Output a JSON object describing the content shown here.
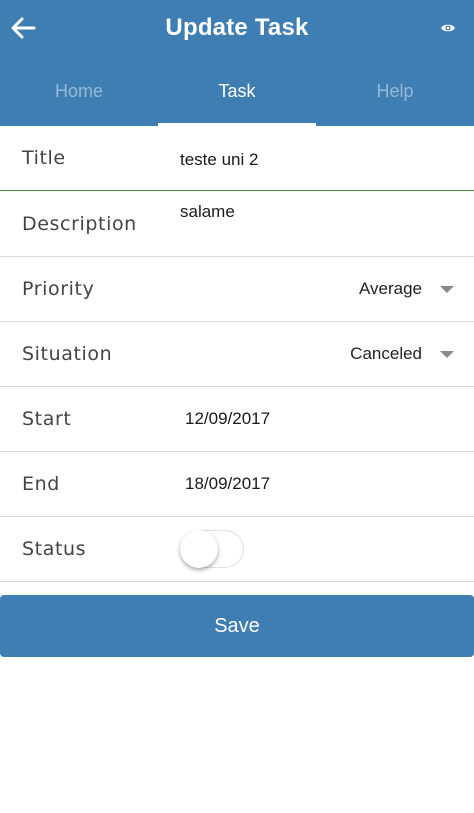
{
  "header": {
    "title": "Update Task",
    "back_icon": "arrow-left-icon",
    "eye_icon": "eye-icon",
    "background_color": "#3f7eb2"
  },
  "tabs": [
    {
      "label": "Home",
      "active": false
    },
    {
      "label": "Task",
      "active": true
    },
    {
      "label": "Help",
      "active": false
    }
  ],
  "form": {
    "title": {
      "label": "Title",
      "value": "teste uni 2"
    },
    "description": {
      "label": "Description",
      "value": "salame"
    },
    "priority": {
      "label": "Priority",
      "value": "Average"
    },
    "situation": {
      "label": "Situation",
      "value": "Canceled"
    },
    "start": {
      "label": "Start",
      "value": "12/09/2017"
    },
    "end": {
      "label": "End",
      "value": "18/09/2017"
    },
    "status": {
      "label": "Status",
      "checked": false
    }
  },
  "save_button": {
    "label": "Save"
  },
  "colors": {
    "accent": "#3f7eb2",
    "active_field_underline": "#3d8f3d"
  }
}
